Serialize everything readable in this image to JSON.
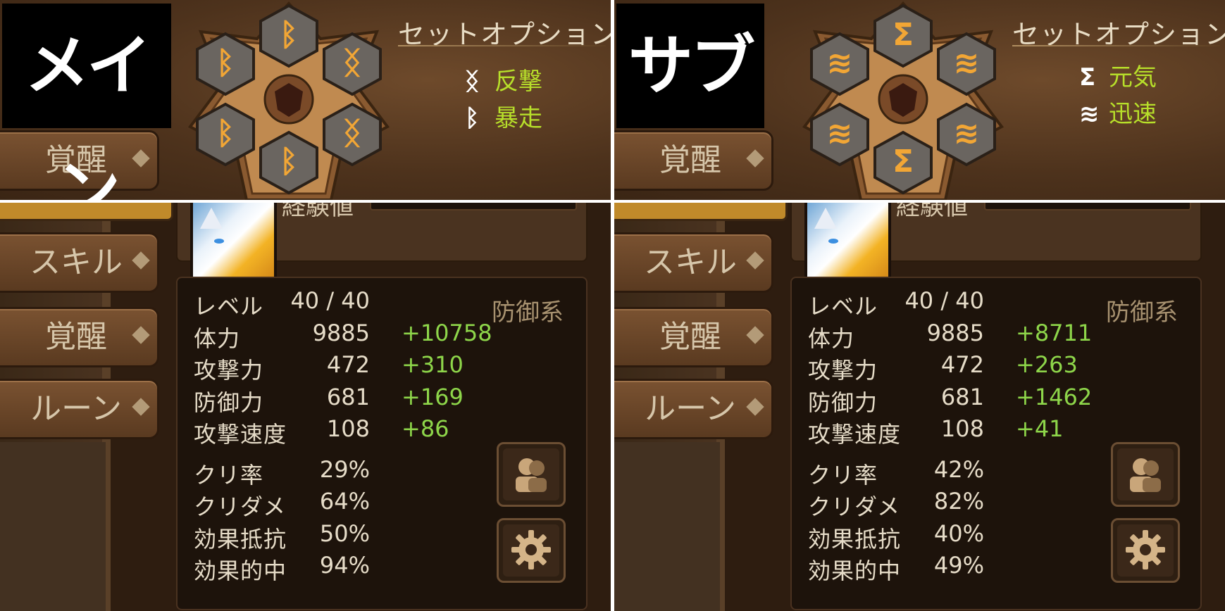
{
  "left": {
    "tag": "メイン",
    "set_title": "セットオプション",
    "set_options": [
      {
        "icon": "counter-rune-icon",
        "glyph": "ᛝ",
        "label": "反撃"
      },
      {
        "icon": "violent-rune-icon",
        "glyph": "ᛒ",
        "label": "暴走"
      }
    ],
    "rune_glyphs": [
      "ᛒ",
      "ᛝ",
      "ᛝ",
      "ᛒ",
      "ᛒ",
      "ᛒ"
    ],
    "tabs": {
      "awaken_top": "覚醒",
      "skill": "スキル",
      "awaken": "覚醒",
      "rune": "ルーン"
    },
    "monster_info_label": "経験値",
    "type_label": "防御系",
    "stats": [
      {
        "label": "レベル",
        "value": "40 / 40",
        "bonus": ""
      },
      {
        "label": "体力",
        "value": "9885",
        "bonus": "+10758"
      },
      {
        "label": "攻撃力",
        "value": "472",
        "bonus": "+310"
      },
      {
        "label": "防御力",
        "value": "681",
        "bonus": "+169"
      },
      {
        "label": "攻撃速度",
        "value": "108",
        "bonus": "+86"
      },
      {
        "label": "クリ率",
        "value": "29%",
        "bonus": ""
      },
      {
        "label": "クリダメ",
        "value": "64%",
        "bonus": ""
      },
      {
        "label": "効果抵抗",
        "value": "50%",
        "bonus": ""
      },
      {
        "label": "効果的中",
        "value": "94%",
        "bonus": ""
      }
    ]
  },
  "right": {
    "tag": "サブ",
    "set_title": "セットオプション",
    "set_options": [
      {
        "icon": "energy-rune-icon",
        "glyph": "Σ",
        "label": "元気"
      },
      {
        "icon": "swift-rune-icon",
        "glyph": "≋",
        "label": "迅速"
      }
    ],
    "rune_glyphs": [
      "Σ",
      "≋",
      "≋",
      "Σ",
      "≋",
      "≋"
    ],
    "tabs": {
      "awaken_top": "覚醒",
      "skill": "スキル",
      "awaken": "覚醒",
      "rune": "ルーン"
    },
    "monster_info_label": "経験値",
    "type_label": "防御系",
    "stats": [
      {
        "label": "レベル",
        "value": "40 / 40",
        "bonus": ""
      },
      {
        "label": "体力",
        "value": "9885",
        "bonus": "+8711"
      },
      {
        "label": "攻撃力",
        "value": "472",
        "bonus": "+263"
      },
      {
        "label": "防御力",
        "value": "681",
        "bonus": "+1462"
      },
      {
        "label": "攻撃速度",
        "value": "108",
        "bonus": "+41"
      },
      {
        "label": "クリ率",
        "value": "42%",
        "bonus": ""
      },
      {
        "label": "クリダメ",
        "value": "82%",
        "bonus": ""
      },
      {
        "label": "効果抵抗",
        "value": "40%",
        "bonus": ""
      },
      {
        "label": "効果的中",
        "value": "49%",
        "bonus": ""
      }
    ]
  },
  "colors": {
    "set_option_text": "#b7df2a",
    "bonus_text": "#8ed64a",
    "rune_slot_glyph": "#f2a635"
  }
}
